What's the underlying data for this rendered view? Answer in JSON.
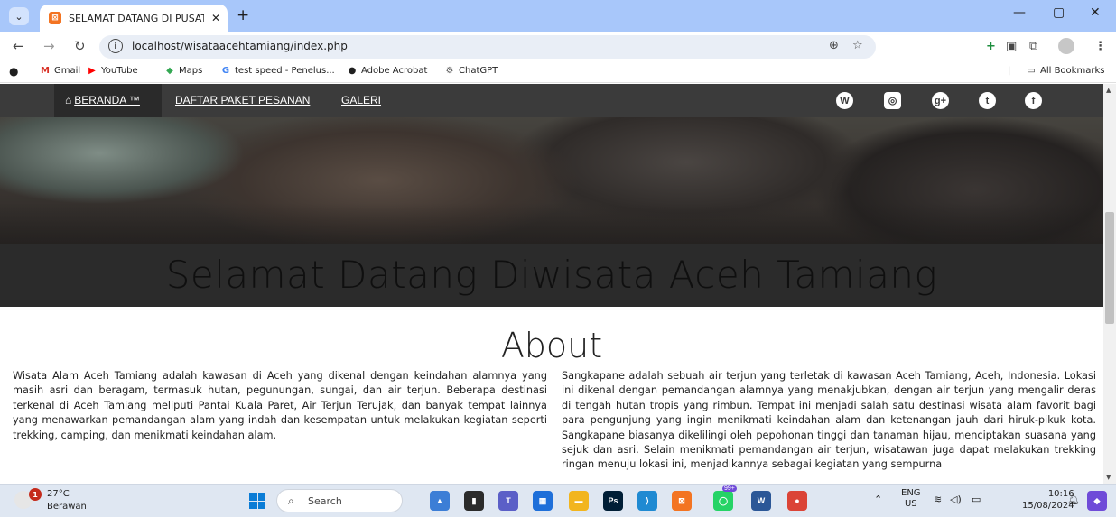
{
  "browser": {
    "tab_title": "SELAMAT DATANG DI PUSAT WISATA",
    "tab_favicon": "xampp-icon",
    "url": "localhost/wisataacehtamiang/index.php",
    "window_controls": {
      "minimize": "—",
      "restore": "▢",
      "close": "✕"
    },
    "bookmarks": [
      {
        "label": "Gmail",
        "icon": "gmail-icon"
      },
      {
        "label": "YouTube",
        "icon": "youtube-icon"
      },
      {
        "label": "Maps",
        "icon": "maps-icon"
      },
      {
        "label": "test speed - Penelus...",
        "icon": "google-icon"
      },
      {
        "label": "Adobe Acrobat",
        "icon": "acrobat-icon"
      },
      {
        "label": "ChatGPT",
        "icon": "chatgpt-icon"
      }
    ],
    "all_bookmarks_label": "All Bookmarks"
  },
  "site_nav": {
    "items": [
      {
        "label": "BERANDA ™",
        "icon": "home-icon",
        "active": true
      },
      {
        "label": "DAFTAR PAKET PESANAN"
      },
      {
        "label": "GALERI"
      }
    ],
    "social": [
      {
        "name": "wordpress-icon",
        "glyph": "W"
      },
      {
        "name": "instagram-icon",
        "glyph": "◎"
      },
      {
        "name": "google-plus-icon",
        "glyph": "g+"
      },
      {
        "name": "twitter-icon",
        "glyph": "t"
      },
      {
        "name": "facebook-icon",
        "glyph": "f"
      }
    ]
  },
  "hero": {
    "welcome_title": "Selamat Datang Diwisata Aceh Tamiang"
  },
  "about": {
    "title": "About",
    "left_text": "Wisata Alam Aceh Tamiang adalah kawasan di Aceh yang dikenal dengan keindahan alamnya yang masih asri dan beragam, termasuk hutan, pegunungan, sungai, dan air terjun. Beberapa destinasi terkenal di Aceh Tamiang meliputi Pantai Kuala Paret, Air Terjun Terujak, dan banyak tempat lainnya yang menawarkan pemandangan alam yang indah dan kesempatan untuk melakukan kegiatan seperti trekking, camping, dan menikmati keindahan alam.",
    "right_text": "Sangkapane adalah sebuah air terjun yang terletak di kawasan Aceh Tamiang, Aceh, Indonesia. Lokasi ini dikenal dengan pemandangan alamnya yang menakjubkan, dengan air terjun yang mengalir deras di tengah hutan tropis yang rimbun. Tempat ini menjadi salah satu destinasi wisata alam favorit bagi para pengunjung yang ingin menikmati keindahan alam dan ketenangan jauh dari hiruk-pikuk kota. Sangkapane biasanya dikelilingi oleh pepohonan tinggi dan tanaman hijau, menciptakan suasana yang sejuk dan asri. Selain menikmati pemandangan air terjun, wisatawan juga dapat melakukan trekking ringan menuju lokasi ini, menjadikannya sebagai kegiatan yang sempurna"
  },
  "taskbar": {
    "weather_temp": "27°C",
    "weather_desc": "Berawan",
    "weather_badge": "1",
    "search_placeholder": "Search",
    "apps": [
      {
        "name": "widgets-icon",
        "color": "#3c7ed6",
        "glyph": "▲"
      },
      {
        "name": "task-view-icon",
        "color": "#2b2b2b",
        "glyph": "▮"
      },
      {
        "name": "teams-icon",
        "color": "#5b5fc7",
        "glyph": "T"
      },
      {
        "name": "store-icon",
        "color": "#1e6fd9",
        "glyph": "▦"
      },
      {
        "name": "file-explorer-icon",
        "color": "#f2b51e",
        "glyph": "▬"
      },
      {
        "name": "photoshop-icon",
        "color": "#001e36",
        "glyph": "Ps"
      },
      {
        "name": "vscode-icon",
        "color": "#1f8ad2",
        "glyph": "⟩"
      },
      {
        "name": "xampp-icon",
        "color": "#f37422",
        "glyph": "⊠"
      },
      {
        "name": "whatsapp-icon",
        "color": "#25d366",
        "glyph": "◯"
      },
      {
        "name": "word-icon",
        "color": "#2b5797",
        "glyph": "W"
      },
      {
        "name": "chrome-icon",
        "color": "#db4437",
        "glyph": "●"
      }
    ],
    "whatsapp_badge": "99+",
    "language": "ENG",
    "region": "US",
    "time": "10:16",
    "date": "15/08/2024"
  }
}
